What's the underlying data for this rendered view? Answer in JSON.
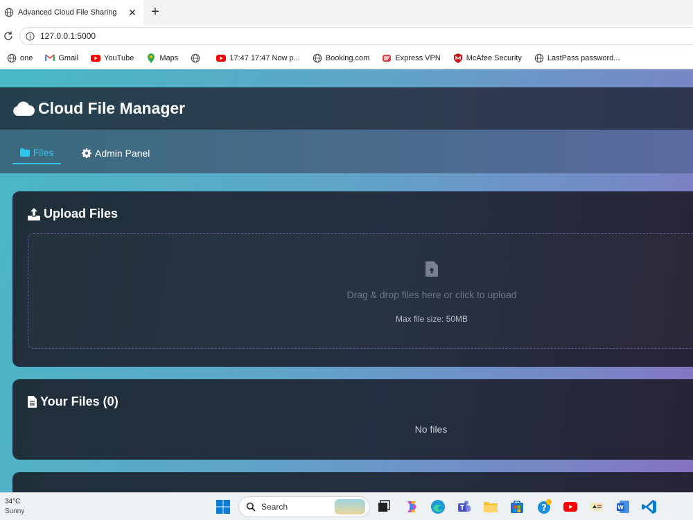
{
  "browser": {
    "tab_title": "Advanced Cloud File Sharing",
    "close_glyph": "✕",
    "newtab_glyph": "+",
    "url": "127.0.0.1:5000",
    "bookmarks": [
      {
        "label": "one",
        "icon": "globe-icon"
      },
      {
        "label": "Gmail",
        "icon": "gmail-icon"
      },
      {
        "label": "YouTube",
        "icon": "youtube-icon"
      },
      {
        "label": "Maps",
        "icon": "maps-icon"
      },
      {
        "label": "",
        "icon": "globe-icon"
      },
      {
        "label": "17:47 17:47 Now p...",
        "icon": "youtube-icon"
      },
      {
        "label": "Booking.com",
        "icon": "globe-icon"
      },
      {
        "label": "Express VPN",
        "icon": "expressvpn-icon"
      },
      {
        "label": "McAfee Security",
        "icon": "mcafee-icon"
      },
      {
        "label": "LastPass password...",
        "icon": "globe-icon"
      }
    ]
  },
  "app": {
    "title": "Cloud File Manager",
    "nav": {
      "files": "Files",
      "admin": "Admin Panel"
    },
    "upload": {
      "title": "Upload Files",
      "drop_text": "Drag & drop files here or click to upload",
      "max_size": "Max file size: 50MB"
    },
    "files": {
      "title": "Your Files (0)",
      "empty": "No files"
    }
  },
  "taskbar": {
    "temp": "34°C",
    "condition": "Sunny",
    "search_label": "Search"
  },
  "colors": {
    "accent": "#2fc5ec",
    "header_bg": "#2d3e52",
    "card_bg": "#242f40"
  }
}
